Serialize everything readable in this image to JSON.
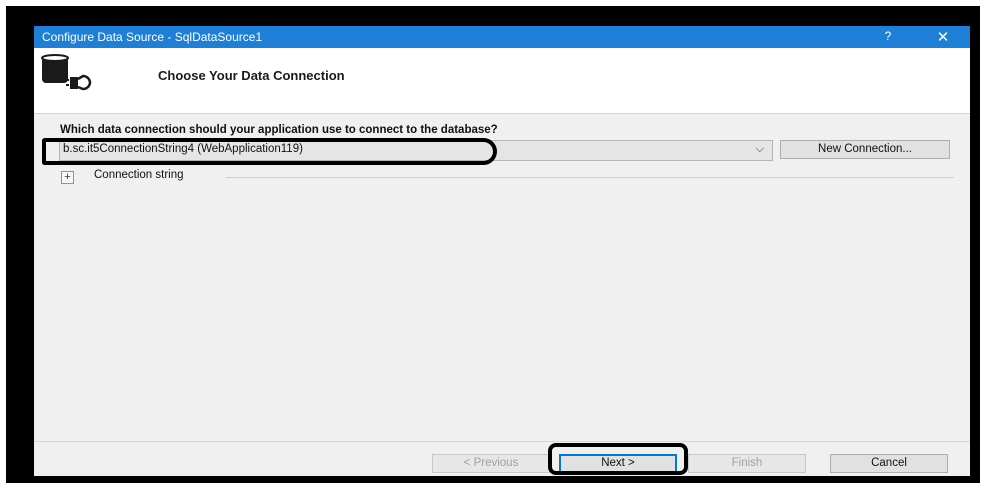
{
  "window": {
    "title": "Configure Data Source - SqlDataSource1",
    "help_glyph": "?",
    "close_glyph": "✕"
  },
  "header": {
    "title": "Choose Your Data Connection",
    "icon": "database-plug-icon"
  },
  "main": {
    "question": "Which data connection should your application use to connect to the database?",
    "connection_value": "b.sc.it5ConnectionString4 (WebApplication119)",
    "dropdown_glyph": "⌵",
    "new_connection_label": "New Connection...",
    "expander_glyph": "+",
    "connection_string_label": "Connection string"
  },
  "footer": {
    "previous_label": "< Previous",
    "next_label": "Next >",
    "finish_label": "Finish",
    "cancel_label": "Cancel"
  },
  "colors": {
    "titlebar": "#1e7fd6",
    "primary_border": "#0078d7",
    "annotation": "#000000"
  }
}
